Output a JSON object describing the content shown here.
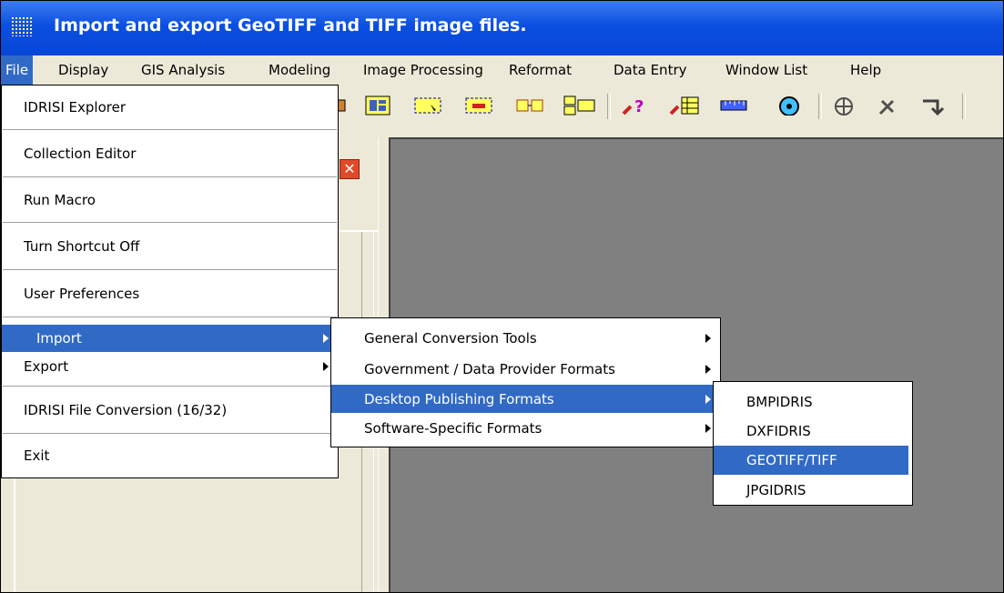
{
  "title_bar": {
    "title": "Import and export GeoTIFF and TIFF image files."
  },
  "menubar": {
    "items": [
      "File",
      "Display",
      "GIS Analysis",
      "Modeling",
      "Image Processing",
      "Reformat",
      "Data Entry",
      "Window List",
      "Help"
    ]
  },
  "file_menu": {
    "items": [
      "IDRISI Explorer",
      "Collection Editor",
      "Run Macro",
      "Turn Shortcut Off",
      "User Preferences",
      "Import",
      "Export",
      "IDRISI File Conversion (16/32)",
      "Exit"
    ]
  },
  "import_submenu": {
    "items": [
      "General Conversion Tools",
      "Government / Data Provider Formats",
      "Desktop Publishing Formats",
      "Software-Specific Formats"
    ]
  },
  "desktop_publishing_submenu": {
    "items": [
      "BMPIDRIS",
      "DXFIDRIS",
      "GEOTIFF/TIFF",
      "JPGIDRIS"
    ]
  },
  "side_panel": {
    "close_glyph": "✕"
  },
  "colors": {
    "title_blue": "#0a4fe0",
    "highlight": "#316ac5",
    "workspace": "#808080"
  },
  "icons": [
    "app-grid-icon",
    "toolbar-icons",
    "close-icon",
    "submenu-arrow-icon"
  ]
}
